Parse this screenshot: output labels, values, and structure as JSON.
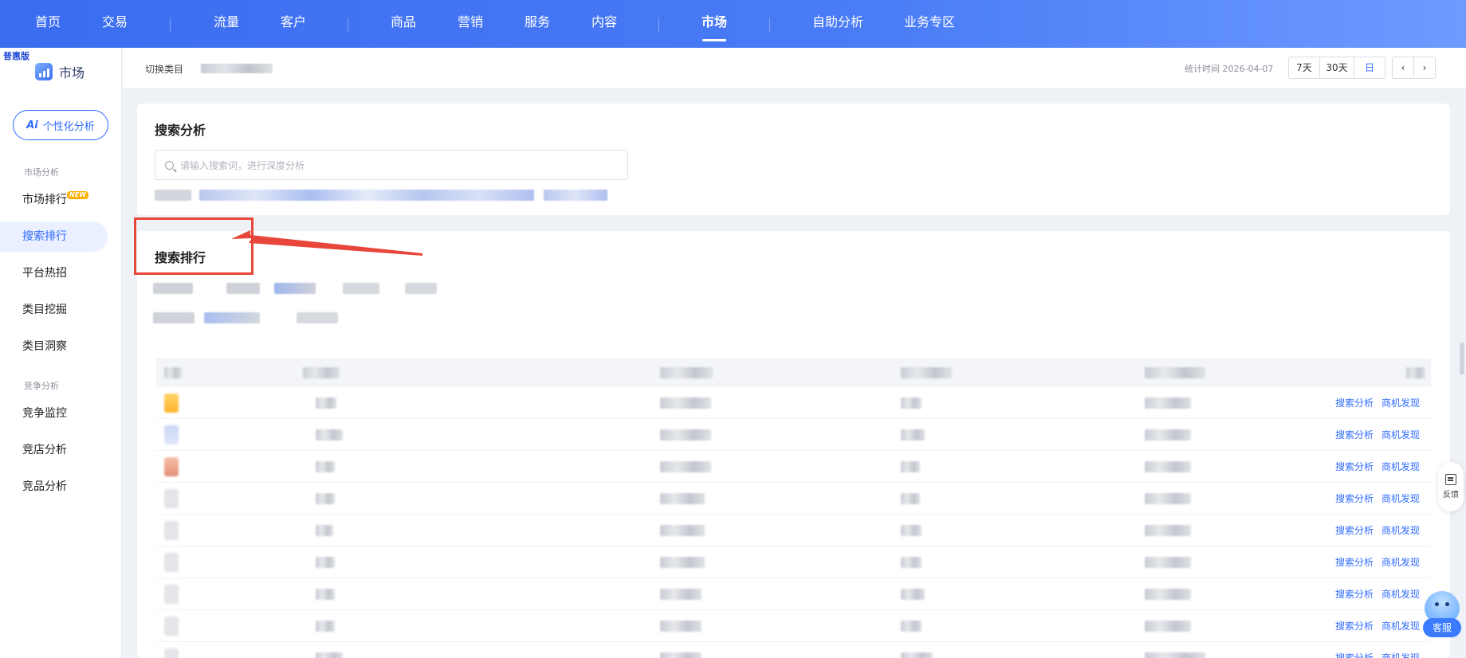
{
  "topnav": {
    "items": [
      "首页",
      "交易",
      "流量",
      "客户",
      "商品",
      "营销",
      "服务",
      "内容",
      "市场",
      "自助分析",
      "业务专区"
    ],
    "active": "市场"
  },
  "sidebar": {
    "edition": "普惠版",
    "module_title": "市场",
    "ai_button": "个性化分析",
    "ai_mark": "Ai",
    "groups": {
      "market_analysis": "市场分析",
      "competition_analysis": "竞争分析"
    },
    "items": [
      {
        "label": "市场排行",
        "badge": "NEW"
      },
      {
        "label": "搜索排行"
      },
      {
        "label": "平台热招"
      },
      {
        "label": "类目挖掘"
      },
      {
        "label": "类目洞察"
      },
      {
        "label": "竞争监控"
      },
      {
        "label": "竞店分析"
      },
      {
        "label": "竞品分析"
      }
    ]
  },
  "subbar": {
    "switch_category_label": "切换类目",
    "stat_time": "统计时间 2026-04-07",
    "range_buttons": [
      "7天",
      "30天",
      "日"
    ],
    "prev": "‹",
    "next": "›"
  },
  "search_card": {
    "title": "搜索分析",
    "placeholder": "请输入搜索词，进行深度分析"
  },
  "ranking_card": {
    "title": "搜索排行",
    "row_actions": [
      "搜索分析",
      "商机发现"
    ]
  },
  "floating": {
    "feedback": "反馈",
    "service": "客服"
  },
  "colors": {
    "brand": "#2f6bff",
    "nav_gradient_start": "#3a6cf0",
    "annotation": "#e8463a"
  }
}
